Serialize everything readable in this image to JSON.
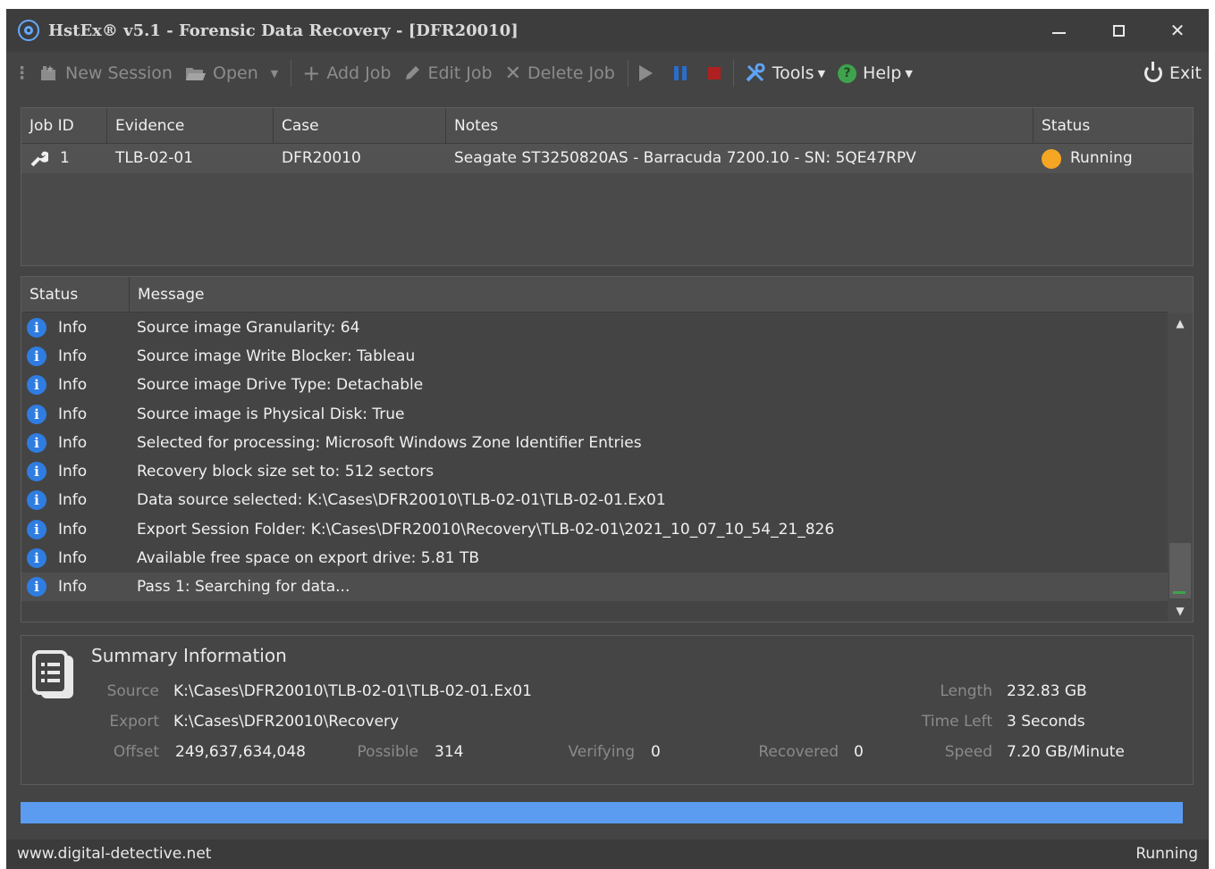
{
  "window": {
    "title": "HstEx® v5.1 - Forensic Data Recovery - [DFR20010]",
    "controls": {
      "minimize": "minimize",
      "maximize": "maximize",
      "close": "✕"
    }
  },
  "toolbar": {
    "new_session": "New Session",
    "open": "Open",
    "add_job": "Add Job",
    "edit_job": "Edit Job",
    "delete_job": "Delete Job",
    "tools": "Tools",
    "help": "Help",
    "exit": "Exit"
  },
  "job_grid": {
    "columns": [
      "Job ID",
      "Evidence",
      "Case",
      "Notes",
      "Status"
    ],
    "rows": [
      {
        "job_id": "1",
        "evidence": "TLB-02-01",
        "case": "DFR20010",
        "notes": "Seagate ST3250820AS - Barracuda 7200.10 - SN: 5QE47RPV",
        "status": "Running"
      }
    ]
  },
  "log_grid": {
    "columns": [
      "Status",
      "Message"
    ],
    "rows": [
      {
        "status": "Info",
        "message": "Source image Granularity: 64"
      },
      {
        "status": "Info",
        "message": "Source image Write Blocker: Tableau"
      },
      {
        "status": "Info",
        "message": "Source image Drive Type: Detachable"
      },
      {
        "status": "Info",
        "message": "Source image is Physical Disk: True"
      },
      {
        "status": "Info",
        "message": "Selected for processing: Microsoft Windows Zone Identifier Entries"
      },
      {
        "status": "Info",
        "message": "Recovery block size set to: 512 sectors"
      },
      {
        "status": "Info",
        "message": "Data source selected: K:\\Cases\\DFR20010\\TLB-02-01\\TLB-02-01.Ex01"
      },
      {
        "status": "Info",
        "message": "Export Session Folder: K:\\Cases\\DFR20010\\Recovery\\TLB-02-01\\2021_10_07_10_54_21_826"
      },
      {
        "status": "Info",
        "message": "Available free space on export drive: 5.81 TB"
      },
      {
        "status": "Info",
        "message": "Pass 1: Searching for data..."
      }
    ]
  },
  "summary": {
    "title": "Summary Information",
    "source_label": "Source",
    "source_value": "K:\\Cases\\DFR20010\\TLB-02-01\\TLB-02-01.Ex01",
    "export_label": "Export",
    "export_value": "K:\\Cases\\DFR20010\\Recovery",
    "offset_label": "Offset",
    "offset_value": "249,637,634,048",
    "possible_label": "Possible",
    "possible_value": "314",
    "verifying_label": "Verifying",
    "verifying_value": "0",
    "recovered_label": "Recovered",
    "recovered_value": "0",
    "length_label": "Length",
    "length_value": "232.83 GB",
    "time_left_label": "Time Left",
    "time_left_value": "3 Seconds",
    "speed_label": "Speed",
    "speed_value": "7.20 GB/Minute"
  },
  "progress": {
    "fraction": 1.0
  },
  "statusbar": {
    "left": "www.digital-detective.net",
    "right": "Running"
  },
  "colors": {
    "background": "#444444",
    "accent": "#5b9cf0",
    "running_status": "#f5a623",
    "info_icon": "#2f7de1",
    "help_icon": "#3fa34d",
    "stop_icon": "#b02020"
  },
  "icons": {
    "app": "app-logo-icon",
    "new_session": "new-session-icon",
    "open": "folder-open-icon",
    "add_job": "plus-icon",
    "edit_job": "pencil-icon",
    "delete_job": "x-icon",
    "start": "play-icon",
    "pause": "pause-icon",
    "stop": "stop-icon",
    "tools": "tools-icon",
    "help": "help-icon",
    "exit": "power-icon",
    "job": "wrench-icon",
    "info": "info-icon",
    "summary": "document-list-icon"
  }
}
